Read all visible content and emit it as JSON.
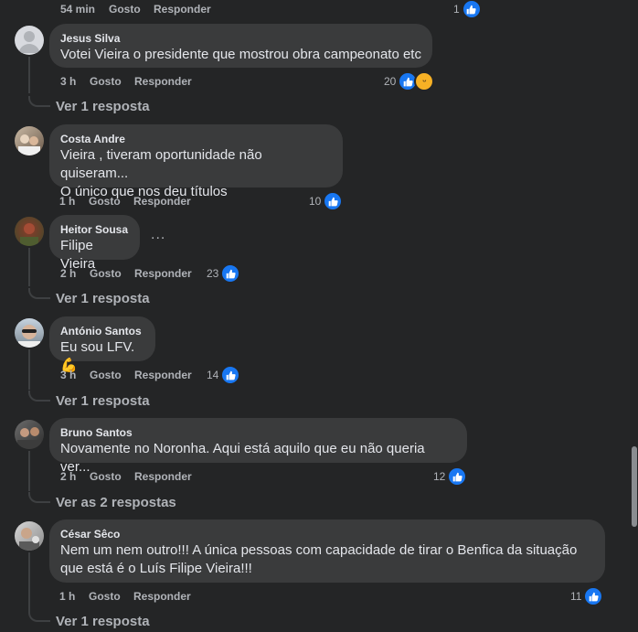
{
  "top": {
    "time": "54 min",
    "like": "Gosto",
    "reply": "Responder",
    "count": "1"
  },
  "comments": [
    {
      "author": "Jesus Silva",
      "lines": [
        "Votei Vieira o presidente que mostrou obra campeonato etc"
      ],
      "time": "3 h",
      "like": "Gosto",
      "reply": "Responder",
      "count": "20",
      "replies": "Ver 1 resposta",
      "avatar_icon": "default-avatar-icon"
    },
    {
      "author": "Costa Andre",
      "lines": [
        "Vieira , tiveram oportunidade não quiseram...",
        "O único que nos deu títulos"
      ],
      "time": "1 h",
      "like": "Gosto",
      "reply": "Responder",
      "count": "10",
      "avatar_icon": "photo-avatar-icon"
    },
    {
      "author": "Heitor Sousa",
      "lines": [
        "Filipe Vieira"
      ],
      "more": "...",
      "time": "2 h",
      "like": "Gosto",
      "reply": "Responder",
      "count": "23",
      "replies": "Ver 1 resposta",
      "avatar_icon": "photo-avatar-icon"
    },
    {
      "author": "António Santos",
      "lines": [
        "Eu sou LFV.💪"
      ],
      "time": "3 h",
      "like": "Gosto",
      "reply": "Responder",
      "count": "14",
      "replies": "Ver 1 resposta",
      "avatar_icon": "photo-avatar-icon"
    },
    {
      "author": "Bruno Santos",
      "lines": [
        "Novamente no Noronha. Aqui está aquilo que eu não queria ver..."
      ],
      "time": "2 h",
      "like": "Gosto",
      "reply": "Responder",
      "count": "12",
      "replies": "Ver as 2 respostas",
      "avatar_icon": "photo-avatar-icon"
    },
    {
      "author": "César Sêco",
      "lines": [
        "Nem um nem outro!!! A única pessoas com capacidade de tirar o Benfica da situação",
        "que está é o Luís Filipe Vieira!!!"
      ],
      "time": "1 h",
      "like": "Gosto",
      "reply": "Responder",
      "count": "11",
      "replies": "Ver 1 resposta",
      "avatar_icon": "photo-avatar-icon"
    }
  ],
  "colors": {
    "background": "#242526",
    "bubble": "#3a3b3c",
    "like": "#1877f2",
    "meta": "#b0b3b8",
    "text": "#e4e6eb"
  }
}
